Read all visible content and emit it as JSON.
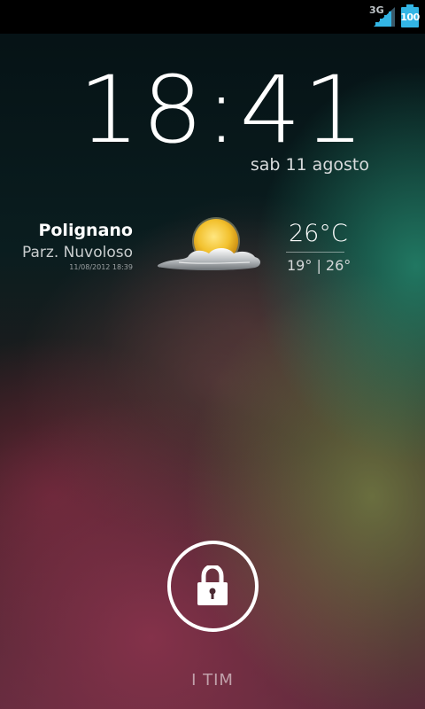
{
  "status_bar": {
    "network_type": "3G",
    "signal_icon": "signal-icon",
    "battery_icon": "battery-icon",
    "battery_level": "100",
    "accent_color": "#33b5e5"
  },
  "lockscreen": {
    "time": "18:41",
    "date": "sab 11 agosto",
    "carrier": "I TIM",
    "unlock_icon": "lock-icon"
  },
  "weather": {
    "city": "Polignano",
    "condition": "Parz. Nuvoloso",
    "updated": "11/08/2012 18:39",
    "icon": "partly-cloudy-icon",
    "temperature": "26°C",
    "range": "19° | 26°"
  }
}
